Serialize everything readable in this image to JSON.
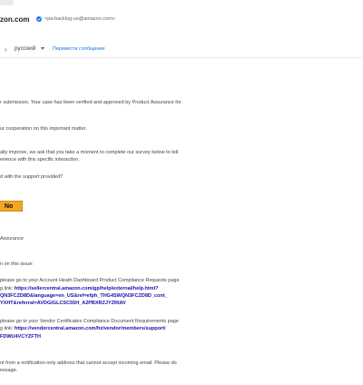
{
  "header": {
    "sender_name": "zon.com",
    "sender_email": "<pa-backlog-us@amazon.com>",
    "icons": {
      "verified": "verified-badge-icon",
      "back": "chevron-right-icon"
    }
  },
  "translate_bar": {
    "language": "русский",
    "translate_link": "Перевести сообщение"
  },
  "body": {
    "l1": "r submission. Your case has been verified and approved by Product Assurance for",
    "l2": "ur cooperation on this important matter.",
    "l3": "ally improve, we ask that you take a moment to complete our survey below to tell",
    "l4": "erience with this specific interaction.",
    "l5": "d with the support provided?",
    "no_button": "No",
    "l6": "Assurance",
    "l7": "n on this issue:",
    "l8": "please go to your Account Heath Dashboard Product Compliance Requests page",
    "l9_prefix": "g link: ",
    "l9_link": "https://sellercentral.amazon.com/gp/help/external/help.html?",
    "l10_link": "QN3FCZD8D&language=en_US&ref=efph_THG4SWQN3FCZD8D_cont_",
    "l11_link": "YXHT&referral=AVDGIGLCSC55H_A2PBXRZJYZRIAV",
    "l12": "please go to your Vendor Certificates Compliance Document Requirements page",
    "l13_prefix": "g link: ",
    "l13_link": "https://vendorcentral.amazon.com/hz/vendor/members/support/",
    "l14_link": "FDWU4VCYZFTH",
    "l15": "nt from a notification-only address that cannot accept incoming email. Please do",
    "l16": "essage."
  }
}
